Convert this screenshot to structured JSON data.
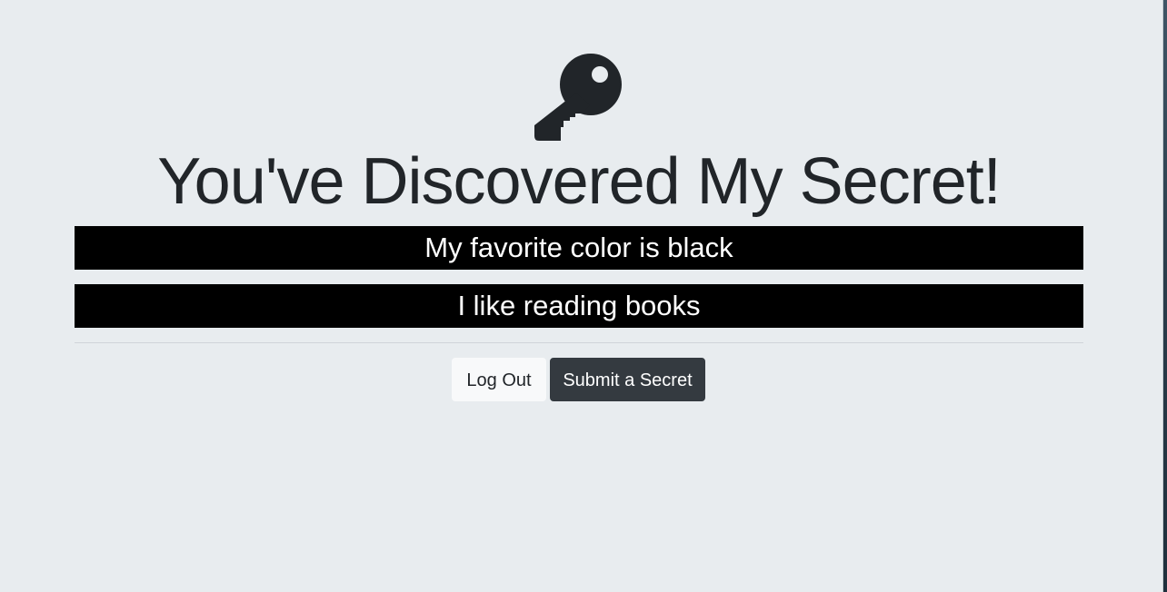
{
  "page": {
    "icon": "key-icon",
    "title": "You've Discovered My Secret!"
  },
  "secrets": [
    "My favorite color is black",
    "I like reading books"
  ],
  "buttons": {
    "logout_label": "Log Out",
    "submit_label": "Submit a Secret"
  },
  "colors": {
    "background": "#e8ecef",
    "secret_bar": "#000000",
    "secret_text": "#ffffff",
    "dark_button": "#343a40",
    "light_button": "#f8f9fa",
    "heading_text": "#212529"
  }
}
